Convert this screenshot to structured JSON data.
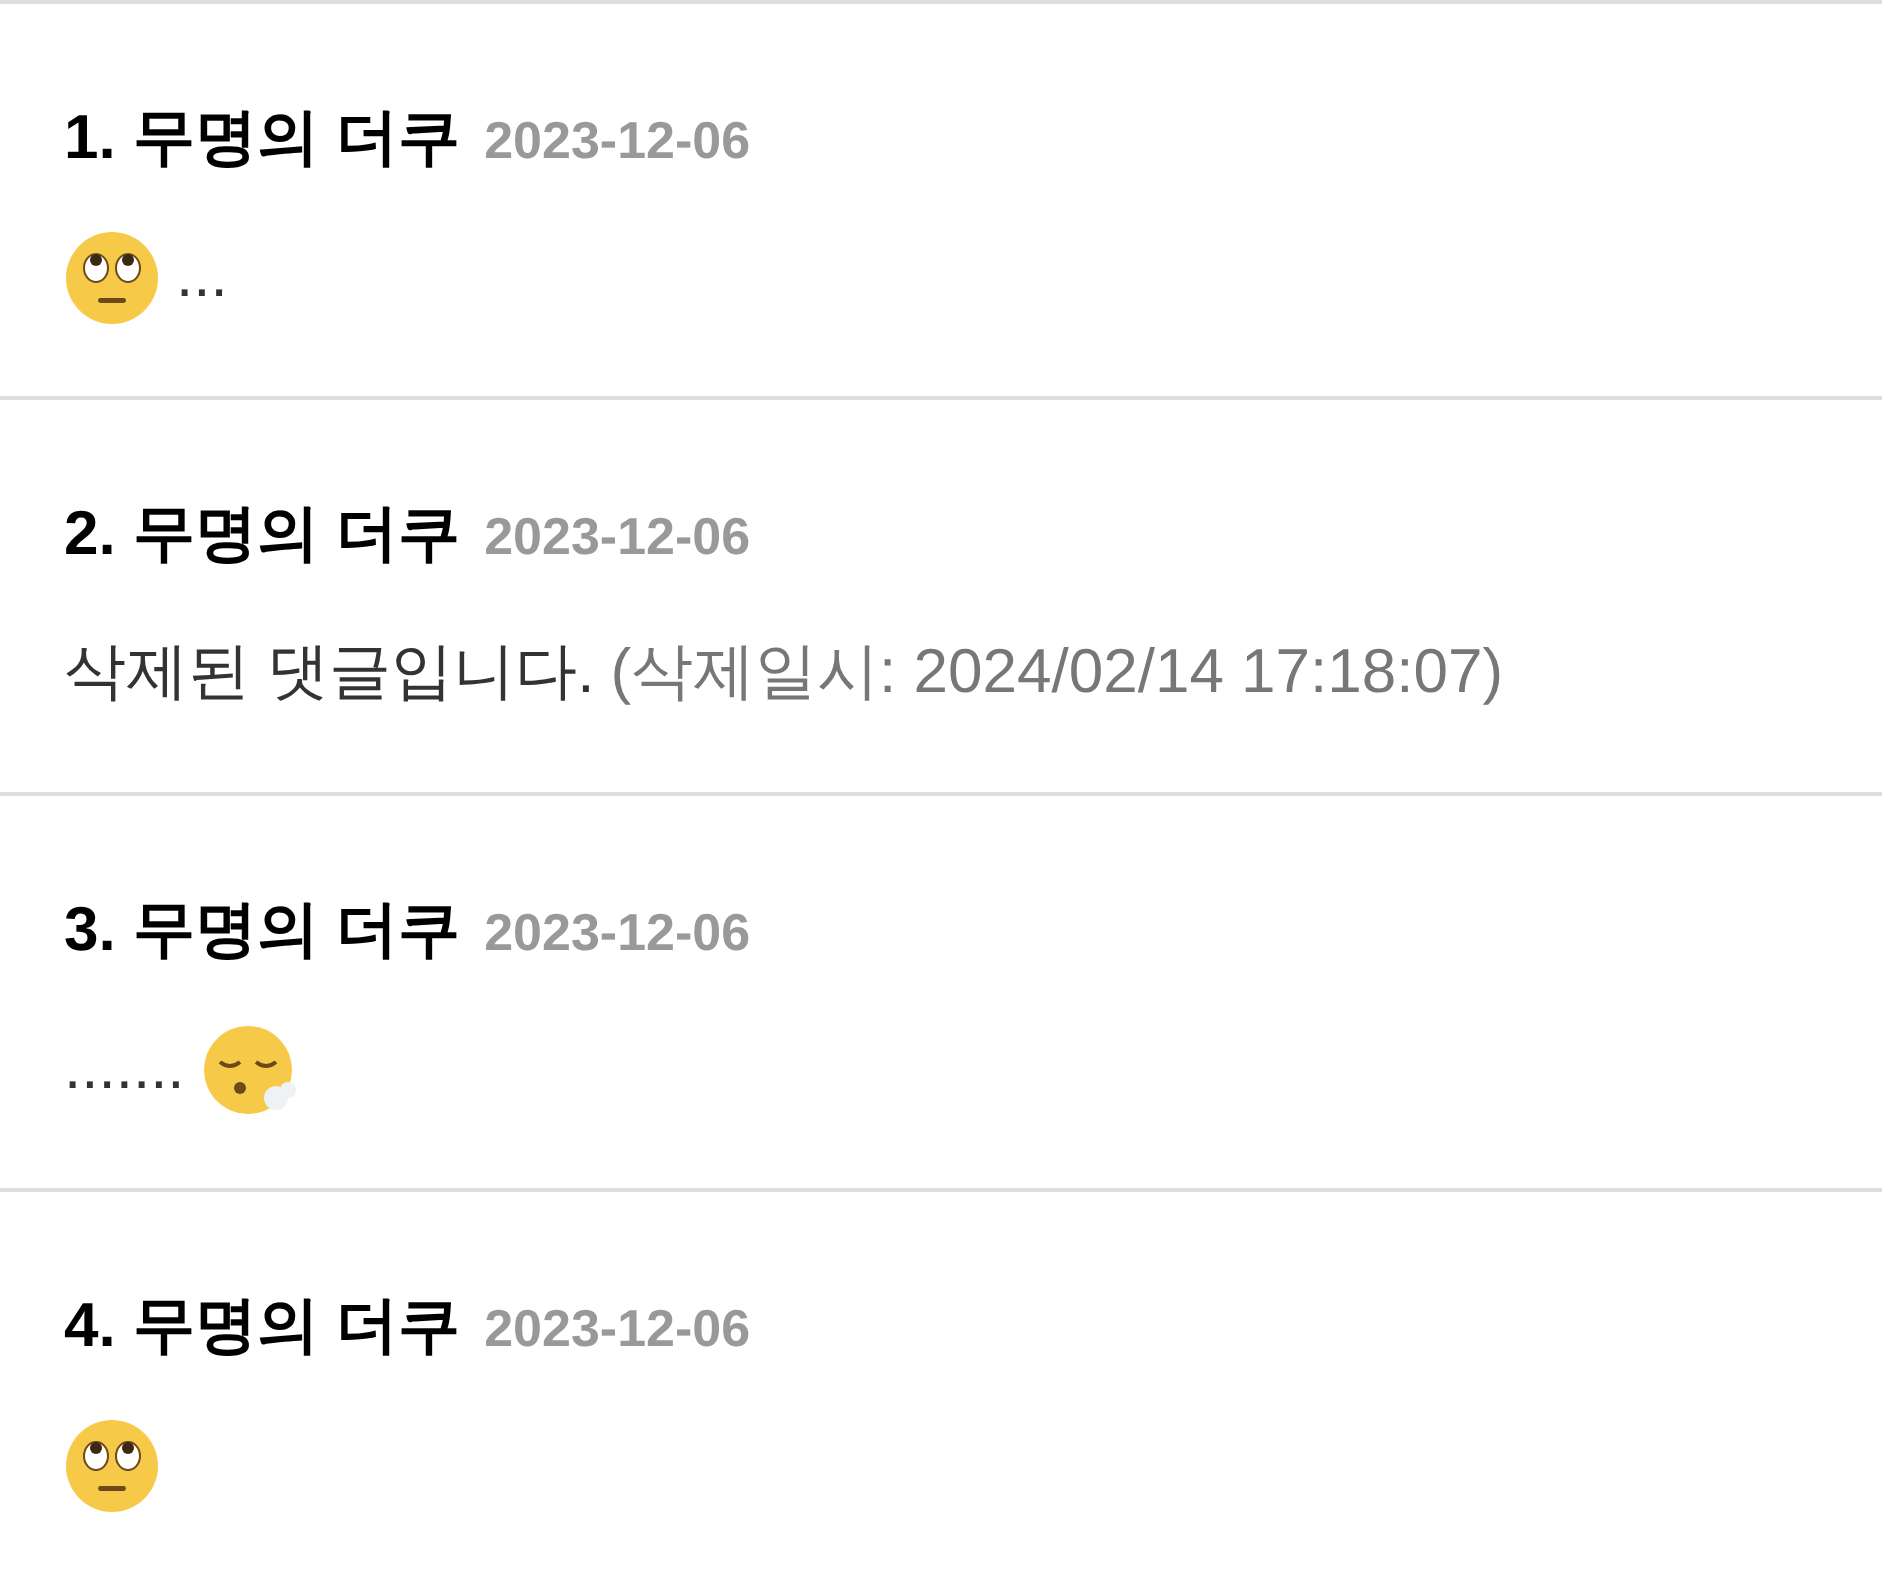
{
  "comments": [
    {
      "title": "1. 무명의 더쿠",
      "date": "2023-12-06",
      "body": [
        {
          "kind": "eye-roll-emoji"
        },
        {
          "kind": "text",
          "text": "..."
        }
      ]
    },
    {
      "title": "2. 무명의 더쿠",
      "date": "2023-12-06",
      "body": [
        {
          "kind": "text",
          "text": "삭제된 댓글입니다."
        },
        {
          "kind": "note",
          "text": "(삭제일시: 2024/02/14 17:18:07)"
        }
      ]
    },
    {
      "title": "3. 무명의 더쿠",
      "date": "2023-12-06",
      "body": [
        {
          "kind": "text",
          "text": "......."
        },
        {
          "kind": "exhale-emoji"
        }
      ]
    },
    {
      "title": "4. 무명의 더쿠",
      "date": "2023-12-06",
      "body": [
        {
          "kind": "eye-roll-emoji"
        }
      ]
    }
  ]
}
